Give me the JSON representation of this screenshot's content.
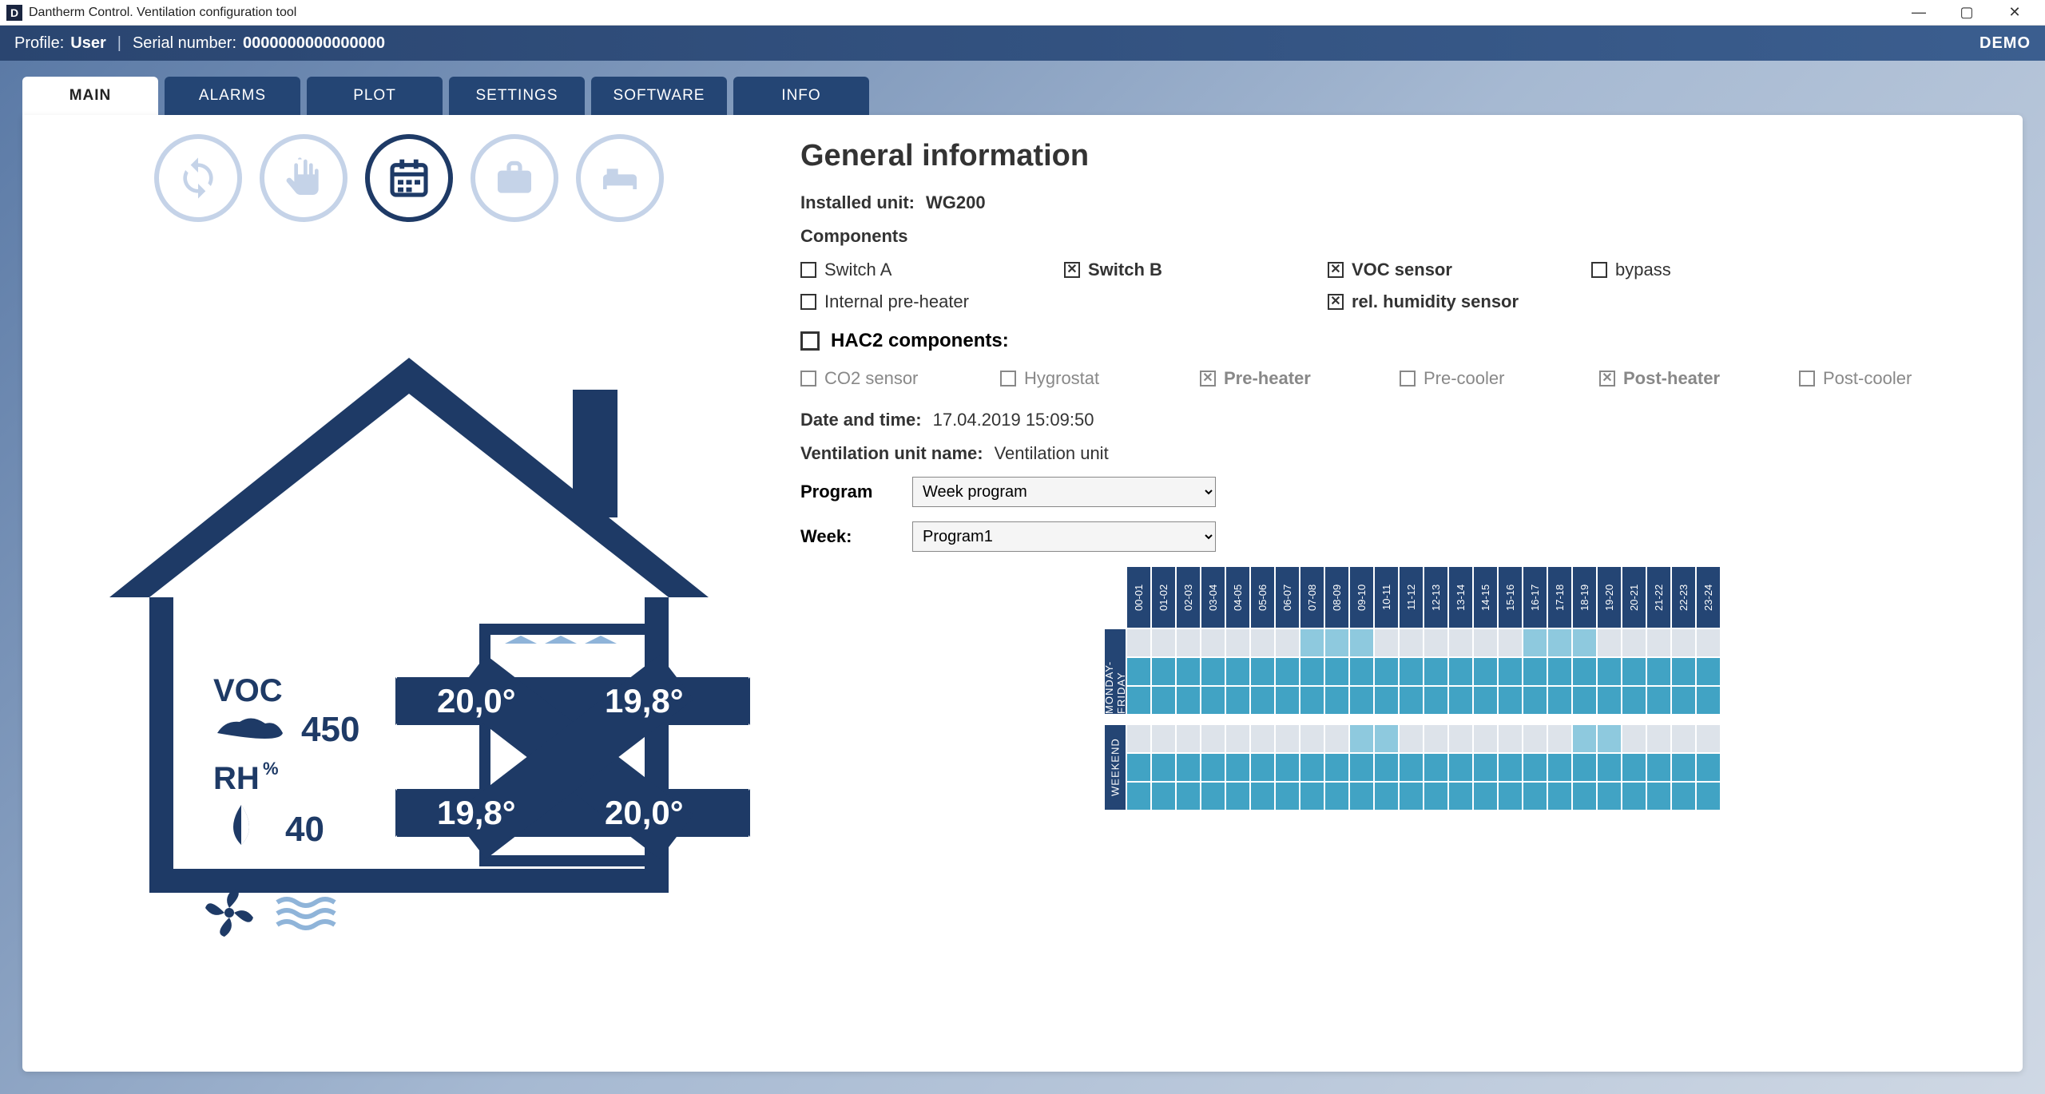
{
  "window": {
    "title": "Dantherm Control. Ventilation configuration tool",
    "logo": "D"
  },
  "header": {
    "profile_label": "Profile:",
    "profile_value": "User",
    "serial_label": "Serial number:",
    "serial_value": "0000000000000000",
    "demo": "DEMO"
  },
  "tabs": [
    "MAIN",
    "ALARMS",
    "PLOT",
    "SETTINGS",
    "SOFTWARE",
    "INFO"
  ],
  "active_tab": 0,
  "modes": [
    "refresh",
    "manual",
    "schedule",
    "briefcase",
    "bed"
  ],
  "active_mode": 2,
  "house": {
    "voc_label": "VOC",
    "voc_value": "450",
    "rh_label": "RH",
    "rh_unit": "%",
    "rh_value": "40",
    "t1": "20,0°",
    "t2": "19,8°",
    "t3": "19,8°",
    "t4": "20,0°"
  },
  "info": {
    "title": "General information",
    "installed_label": "Installed unit:",
    "installed_value": "WG200",
    "components_label": "Components",
    "components": [
      {
        "label": "Switch A",
        "checked": false
      },
      {
        "label": "Switch B",
        "checked": true
      },
      {
        "label": "VOC sensor",
        "checked": true
      },
      {
        "label": "bypass",
        "checked": false
      },
      {
        "label": "Internal pre-heater",
        "checked": false
      },
      {
        "label": "",
        "checked": false
      },
      {
        "label": "rel. humidity sensor",
        "checked": true
      },
      {
        "label": "",
        "checked": false
      }
    ],
    "hac2_label": "HAC2 components:",
    "hac2_checked": false,
    "hac2": [
      {
        "label": "CO2 sensor",
        "checked": false
      },
      {
        "label": "Hygrostat",
        "checked": false
      },
      {
        "label": "Pre-heater",
        "checked": true
      },
      {
        "label": "Pre-cooler",
        "checked": false
      },
      {
        "label": "Post-heater",
        "checked": true
      },
      {
        "label": "Post-cooler",
        "checked": false
      }
    ],
    "datetime_label": "Date and time:",
    "datetime_value": "17.04.2019 15:09:50",
    "unitname_label": "Ventilation unit name:",
    "unitname_value": "Ventilation unit",
    "program_label": "Program",
    "program_value": "Week program",
    "week_label": "Week:",
    "week_value": "Program1"
  },
  "schedule": {
    "hours": [
      "00-01",
      "01-02",
      "02-03",
      "03-04",
      "04-05",
      "05-06",
      "06-07",
      "07-08",
      "08-09",
      "09-10",
      "10-11",
      "11-12",
      "12-13",
      "13-14",
      "14-15",
      "15-16",
      "16-17",
      "17-18",
      "18-19",
      "19-20",
      "20-21",
      "21-22",
      "22-23",
      "23-24"
    ],
    "groups": [
      {
        "label": "MONDAY-FRIDAY",
        "rows": [
          [
            0,
            0,
            0,
            0,
            0,
            0,
            0,
            1,
            1,
            1,
            0,
            0,
            0,
            0,
            0,
            0,
            1,
            1,
            1,
            0,
            0,
            0,
            0,
            0
          ],
          [
            2,
            2,
            2,
            2,
            2,
            2,
            2,
            2,
            2,
            2,
            2,
            2,
            2,
            2,
            2,
            2,
            2,
            2,
            2,
            2,
            2,
            2,
            2,
            2
          ],
          [
            2,
            2,
            2,
            2,
            2,
            2,
            2,
            2,
            2,
            2,
            2,
            2,
            2,
            2,
            2,
            2,
            2,
            2,
            2,
            2,
            2,
            2,
            2,
            2
          ]
        ]
      },
      {
        "label": "WEEKEND",
        "rows": [
          [
            0,
            0,
            0,
            0,
            0,
            0,
            0,
            0,
            0,
            1,
            1,
            0,
            0,
            0,
            0,
            0,
            0,
            0,
            1,
            1,
            0,
            0,
            0,
            0
          ],
          [
            2,
            2,
            2,
            2,
            2,
            2,
            2,
            2,
            2,
            2,
            2,
            2,
            2,
            2,
            2,
            2,
            2,
            2,
            2,
            2,
            2,
            2,
            2,
            2
          ],
          [
            2,
            2,
            2,
            2,
            2,
            2,
            2,
            2,
            2,
            2,
            2,
            2,
            2,
            2,
            2,
            2,
            2,
            2,
            2,
            2,
            2,
            2,
            2,
            2
          ]
        ]
      }
    ]
  }
}
